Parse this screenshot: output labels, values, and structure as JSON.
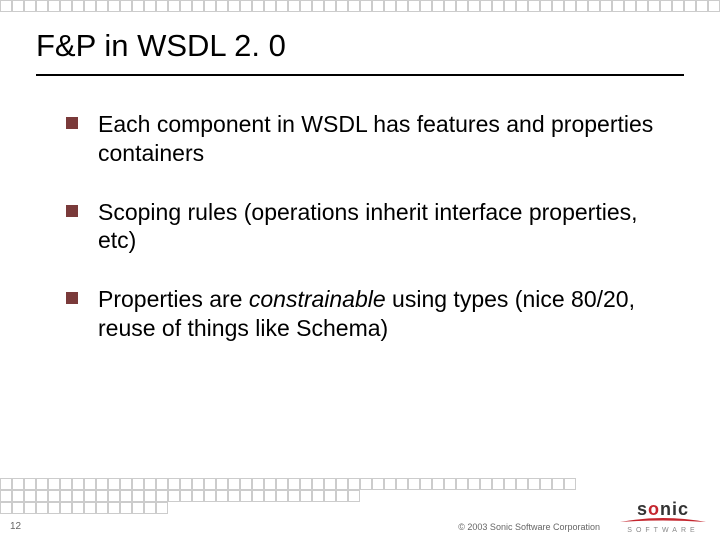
{
  "title": "F&P in WSDL 2. 0",
  "bullets": [
    {
      "text": "Each component in WSDL has features and properties containers"
    },
    {
      "text": "Scoping rules (operations inherit interface properties, etc)"
    },
    {
      "html": "Properties are <em>constrainable</em> using types (nice 80/20, reuse of things like Schema)"
    }
  ],
  "slideNumber": "12",
  "copyright": "© 2003 Sonic Software Corporation",
  "logo": {
    "name": "sonic",
    "sub": "SOFTWARE"
  }
}
